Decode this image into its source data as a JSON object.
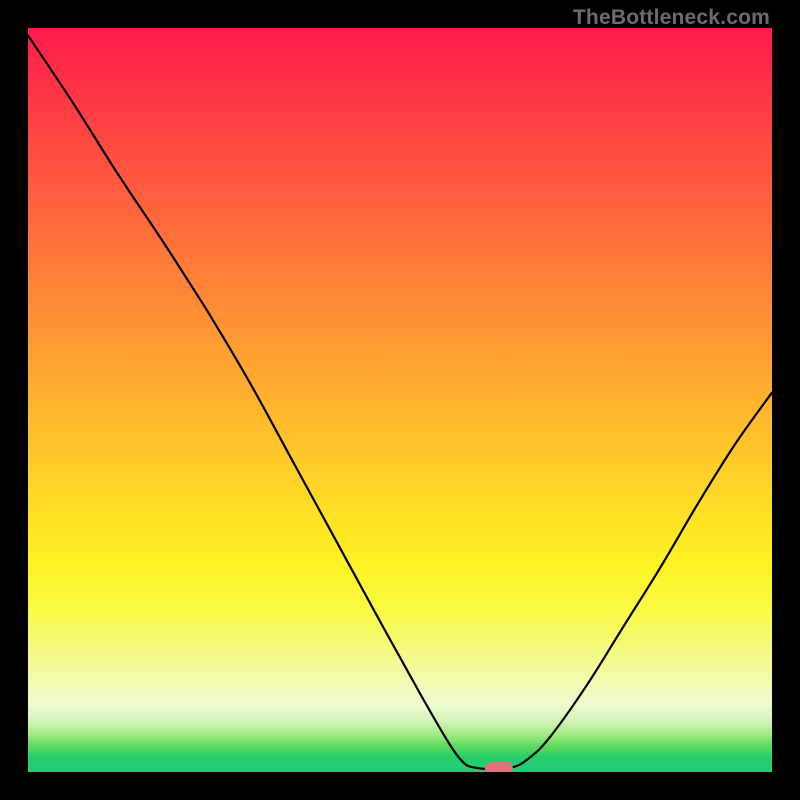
{
  "watermark": "TheBottleneck.com",
  "chart_data": {
    "type": "line",
    "title": "",
    "xlabel": "",
    "ylabel": "",
    "x_range": [
      0,
      100
    ],
    "y_range_percent": [
      0,
      100
    ],
    "curve": [
      {
        "x": 0.0,
        "y": 99.0
      },
      {
        "x": 6.0,
        "y": 90.0
      },
      {
        "x": 12.0,
        "y": 80.5
      },
      {
        "x": 18.0,
        "y": 71.5
      },
      {
        "x": 22.5,
        "y": 64.5
      },
      {
        "x": 25.0,
        "y": 60.5
      },
      {
        "x": 30.0,
        "y": 52.0
      },
      {
        "x": 36.0,
        "y": 41.0
      },
      {
        "x": 42.0,
        "y": 30.0
      },
      {
        "x": 48.0,
        "y": 19.0
      },
      {
        "x": 53.0,
        "y": 10.0
      },
      {
        "x": 56.5,
        "y": 4.0
      },
      {
        "x": 58.5,
        "y": 1.3
      },
      {
        "x": 60.0,
        "y": 0.6
      },
      {
        "x": 62.5,
        "y": 0.4
      },
      {
        "x": 65.0,
        "y": 0.6
      },
      {
        "x": 67.0,
        "y": 1.6
      },
      {
        "x": 70.0,
        "y": 4.5
      },
      {
        "x": 75.0,
        "y": 11.5
      },
      {
        "x": 80.0,
        "y": 19.5
      },
      {
        "x": 85.0,
        "y": 27.5
      },
      {
        "x": 90.0,
        "y": 36.0
      },
      {
        "x": 95.0,
        "y": 44.0
      },
      {
        "x": 100.0,
        "y": 51.0
      }
    ],
    "marker": {
      "x": 63.3,
      "y": 0.4,
      "color": "#e6717c"
    },
    "curve_color": "#000000",
    "curve_width": 2.2
  }
}
